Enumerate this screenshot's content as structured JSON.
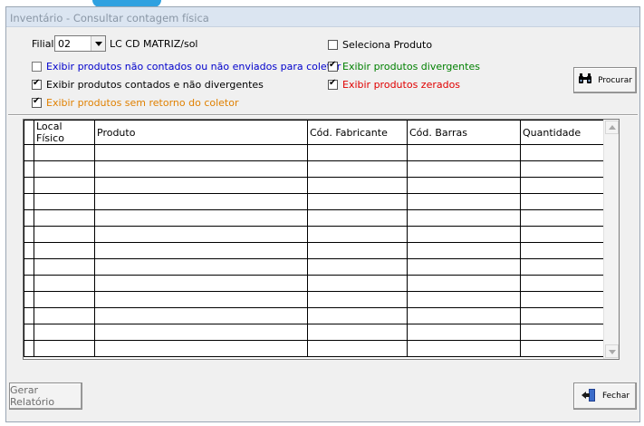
{
  "window": {
    "title": "Inventário - Consultar contagem física"
  },
  "filters": {
    "filial_label": "Filial",
    "filial_value": "02",
    "filial_name": "LC CD MATRIZ/sol",
    "nao_contados": {
      "label": "Exibir produtos não contados ou não enviados para coletor",
      "checked": false,
      "color": "#0000cc"
    },
    "contados": {
      "label": "Exibir produtos contados e não divergentes",
      "checked": true,
      "color": "#000000"
    },
    "sem_retorno": {
      "label": "Exibir produtos sem retorno do coletor",
      "checked": true,
      "color": "#e08000"
    },
    "seleciona_produto": {
      "label": "Seleciona Produto",
      "checked": false,
      "color": "#000000"
    },
    "divergentes": {
      "label": "Exibir produtos divergentes",
      "checked": true,
      "color": "#008000"
    },
    "zerados": {
      "label": "Exibir produtos zerados",
      "checked": true,
      "color": "#e00000"
    }
  },
  "buttons": {
    "procurar": "Procurar",
    "gerar_relatorio": "Gerar Relatório",
    "fechar": "Fechar"
  },
  "grid": {
    "columns": [
      "Local Físico",
      "Produto",
      "Cód. Fabricante",
      "Cód. Barras",
      "Quantidade"
    ],
    "row_count": 13
  }
}
